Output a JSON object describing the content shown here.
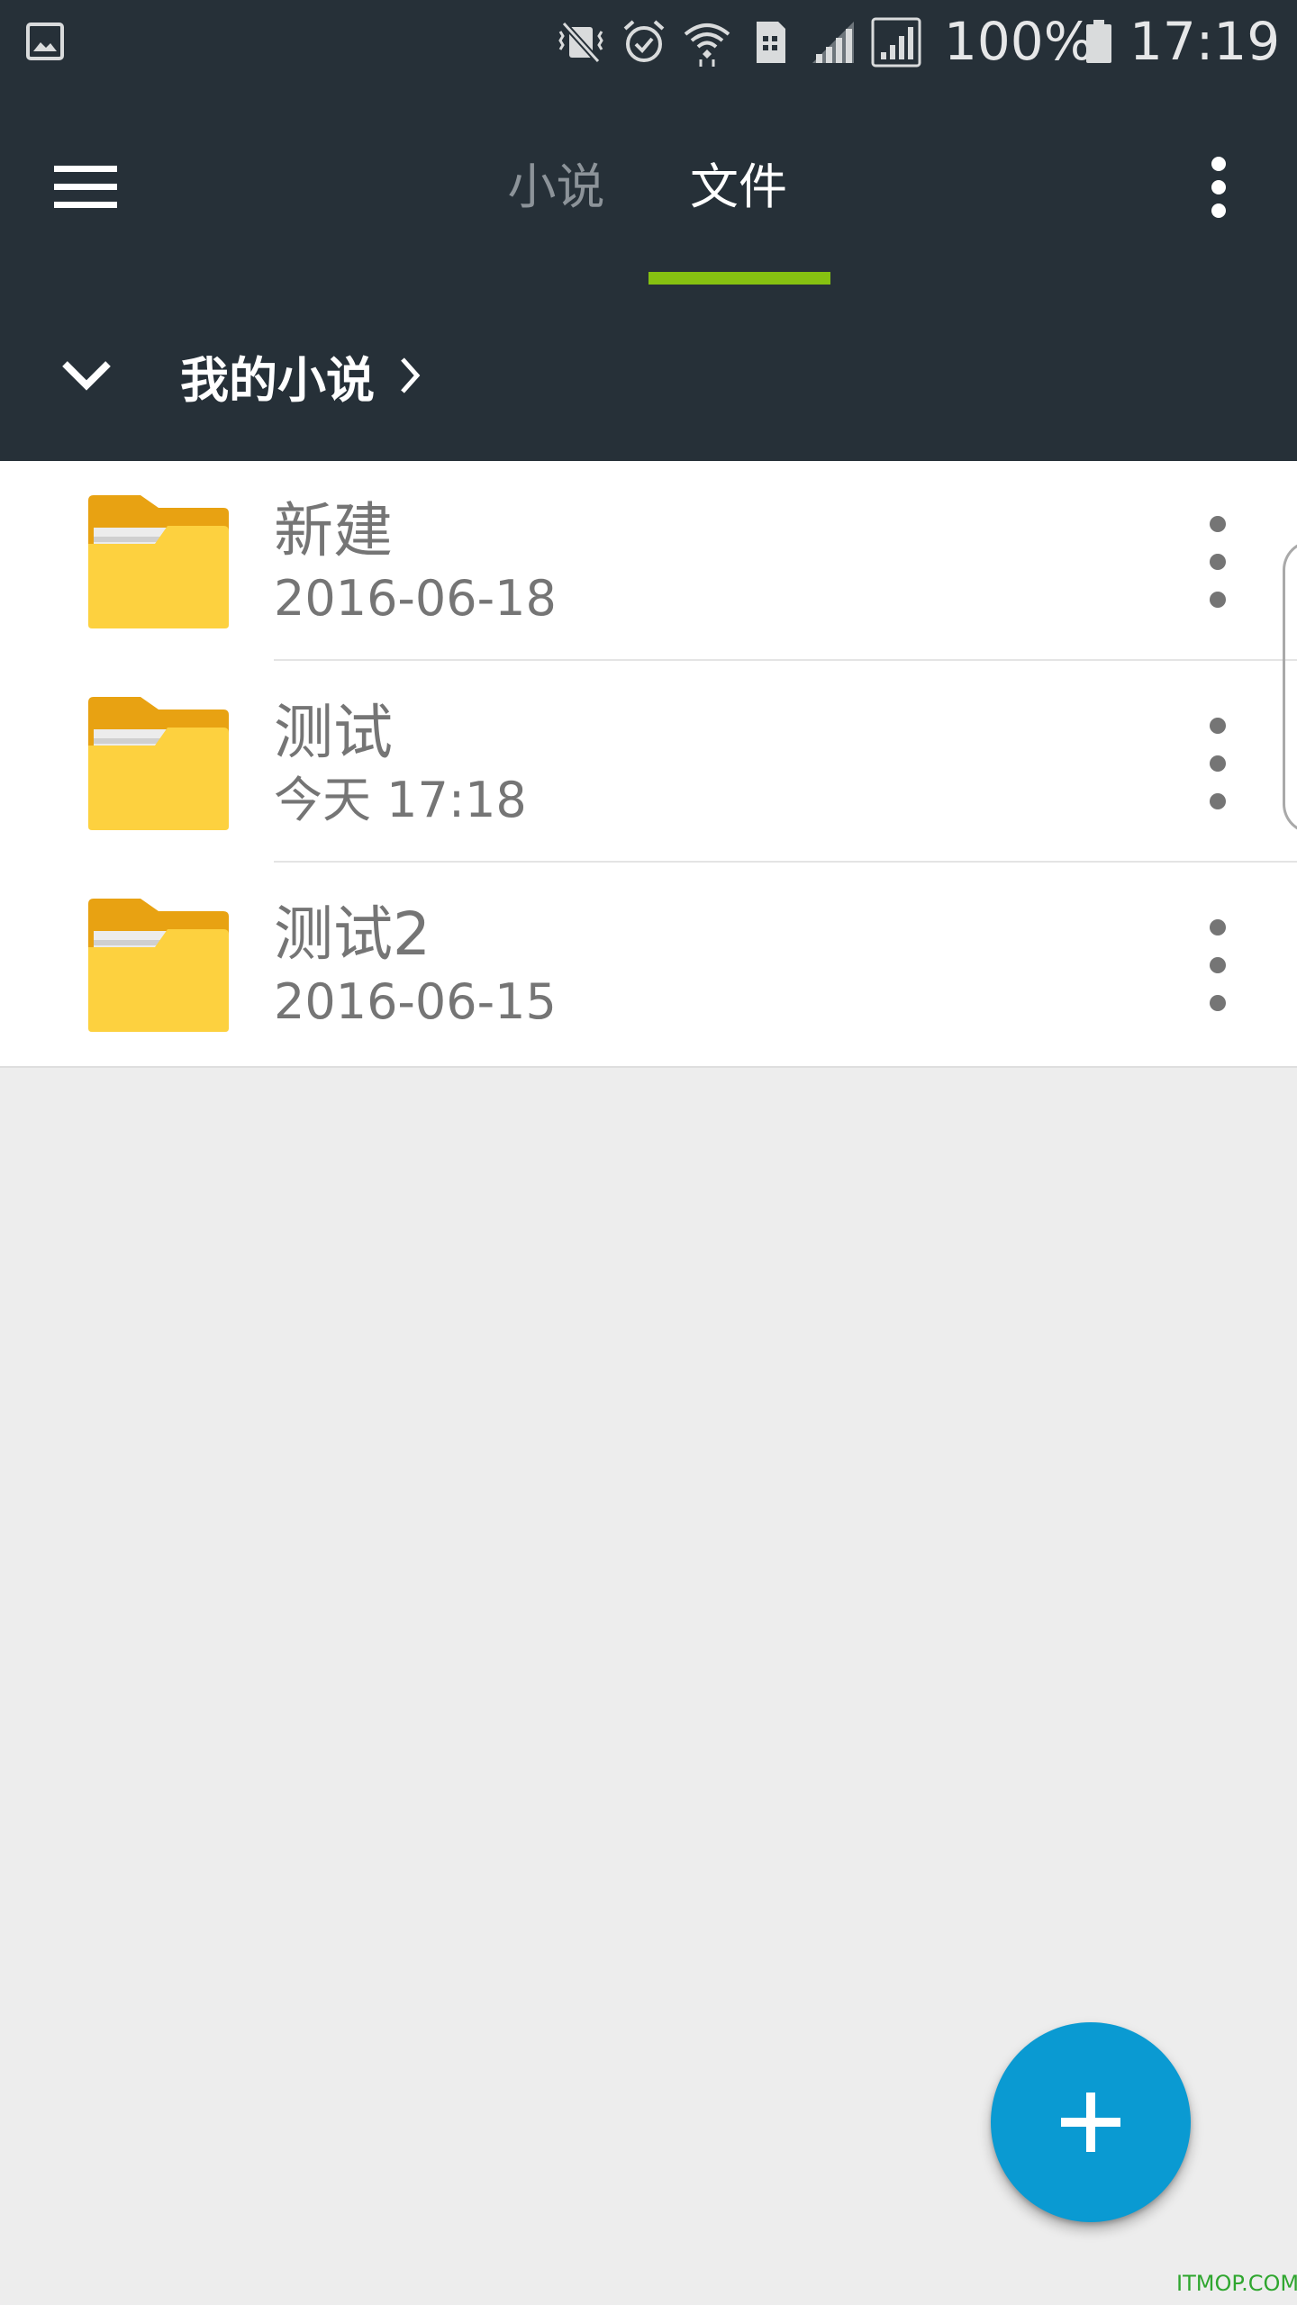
{
  "status_bar": {
    "icons": [
      "gallery-notification-icon",
      "vibrate-mute-icon",
      "alarm-icon",
      "wifi-icon",
      "sim-card-icon",
      "signal-icon",
      "signal-bars-icon"
    ],
    "battery": "100%",
    "time": "17:19"
  },
  "toolbar": {
    "tabs": [
      {
        "label": "小说",
        "active": false
      },
      {
        "label": "文件",
        "active": true
      }
    ],
    "accent_color": "#86c111",
    "background_color": "#263038"
  },
  "breadcrumb": {
    "label": "我的小说"
  },
  "files": [
    {
      "name": "新建",
      "date": "2016-06-18",
      "icon": "folder-icon"
    },
    {
      "name": "测试",
      "date": "今天 17:18",
      "icon": "folder-icon"
    },
    {
      "name": "测试2",
      "date": "2016-06-15",
      "icon": "folder-icon"
    }
  ],
  "fab": {
    "icon": "plus-icon",
    "color": "#0a9ad2"
  },
  "watermark": "ITMOP.COM"
}
